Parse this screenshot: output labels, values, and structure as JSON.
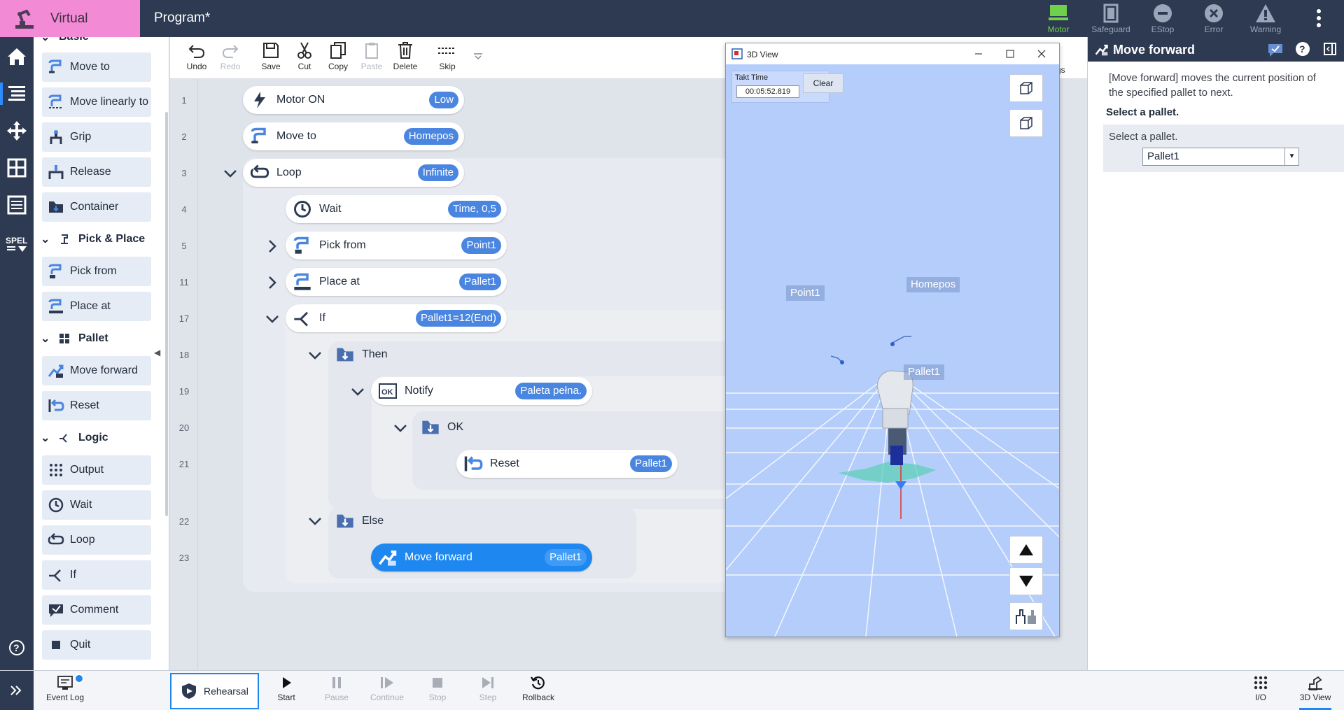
{
  "header": {
    "mode_label": "Virtual",
    "program_title": "Program*",
    "status": [
      {
        "label": "Motor",
        "icon": "motor-icon",
        "color": "#6fd14a"
      },
      {
        "label": "Safeguard",
        "icon": "safeguard-icon"
      },
      {
        "label": "EStop",
        "icon": "estop-icon"
      },
      {
        "label": "Error",
        "icon": "error-icon"
      },
      {
        "label": "Warning",
        "icon": "warning-icon"
      }
    ]
  },
  "leftnav": [
    "home-icon",
    "program-icon",
    "jog-icon",
    "layout-icon",
    "list-icon",
    "spel-icon",
    "help-icon",
    "expand-icon"
  ],
  "palette": {
    "partial_top": "Basic",
    "basic": [
      "Move to",
      "Move linearly to",
      "Grip",
      "Release",
      "Container"
    ],
    "categories": {
      "pick_place": "Pick & Place",
      "pallet": "Pallet",
      "logic": "Logic"
    },
    "pick_place": [
      "Pick from",
      "Place at"
    ],
    "pallet": [
      "Move forward",
      "Reset"
    ],
    "logic": [
      "Output",
      "Wait",
      "Loop",
      "If",
      "Comment",
      "Quit"
    ]
  },
  "toolbar": {
    "undo": "Undo",
    "redo": "Redo",
    "save": "Save",
    "cut": "Cut",
    "copy": "Copy",
    "paste": "Paste",
    "delete": "Delete",
    "skip": "Skip",
    "settings_partial": "gs"
  },
  "program": {
    "lines": [
      "1",
      "2",
      "3",
      "4",
      "5",
      "11",
      "17",
      "18",
      "19",
      "20",
      "21",
      "22",
      "23"
    ],
    "steps": [
      {
        "label": "Motor ON",
        "param": "Low"
      },
      {
        "label": "Move to",
        "param": "Homepos"
      },
      {
        "label": "Loop",
        "param": "Infinite"
      },
      {
        "label": "Wait",
        "param": "Time, 0,5"
      },
      {
        "label": "Pick from",
        "param": "Point1"
      },
      {
        "label": "Place at",
        "param": "Pallet1"
      },
      {
        "label": "If",
        "param": "Pallet1=12(End)"
      },
      {
        "label": "Then"
      },
      {
        "label": "Notify",
        "param": "Paleta pełna."
      },
      {
        "label": "OK"
      },
      {
        "label": "Reset",
        "param": "Pallet1"
      },
      {
        "label": "Else"
      },
      {
        "label": "Move forward",
        "param": "Pallet1"
      }
    ]
  },
  "view3d": {
    "title": "3D View",
    "takt_label": "Takt Time",
    "takt_value": "00:05:52.819",
    "clear": "Clear",
    "labels": {
      "point1": "Point1",
      "homepos": "Homepos",
      "pallet1": "Pallet1"
    }
  },
  "rightpanel": {
    "title": "Move forward",
    "description": "[Move forward] moves the current position of the specified pallet to next.",
    "section": "Select a pallet.",
    "field_label": "Select a pallet.",
    "selected": "Pallet1"
  },
  "bottom": {
    "event_log": "Event Log",
    "rehearsal": "Rehearsal",
    "start": "Start",
    "pause": "Pause",
    "continue": "Continue",
    "stop": "Stop",
    "step": "Step",
    "rollback": "Rollback",
    "io": "I/O",
    "view3d": "3D View"
  }
}
